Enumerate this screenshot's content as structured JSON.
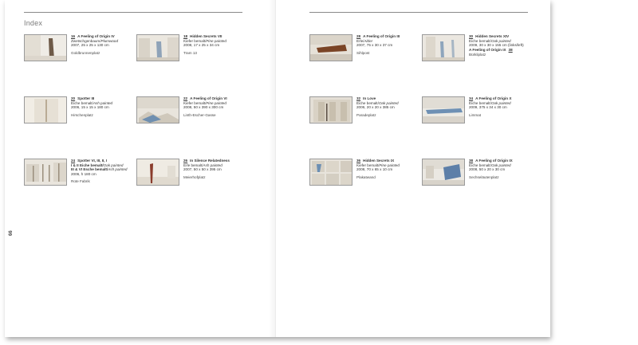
{
  "heading": "Index",
  "page_number": "66",
  "left_items": [
    {
      "num": "16",
      "title": "A Feeling of Origin IV",
      "material": "Zwetschgenbaum",
      "material_en": "Plumwood",
      "dims": "2007, 25 x 25 x 130 cm",
      "location": "Goldbrunnenplatz"
    },
    {
      "num": "18",
      "title": "Hidden Secrets VII",
      "material": "Kiefer bemalt",
      "material_en": "Pine painted",
      "dims": "2008, 17 x 25 x 34 cm",
      "location": "Tram 13"
    },
    {
      "num": "20",
      "title": "Spotter III",
      "material": "Eiche bemalt",
      "material_en": "Ash painted",
      "dims": "2006, 15 x 15 x 180 cm",
      "location": "Hirschenplatz"
    },
    {
      "num": "22",
      "title": "A Feeling of Origin VI",
      "material": "Kiefer bemalt",
      "material_en": "Pine painted",
      "dims": "2008, 50 x 390 x 300 cm",
      "location": "Linth-Escher-Gasse"
    },
    {
      "num": "24",
      "title": "Spotter VI, III, II, I",
      "material": "I & II Eiche bemalt",
      "material_en": "Oak painted",
      "material2": "III & VI Esche bemalt",
      "material2_en": "Ash painted",
      "dims": "2006, h 180 cm",
      "location": "Rote Fabrik"
    },
    {
      "num": "26",
      "title": "In Silence Relatedness",
      "material": "Erle bemalt",
      "material_en": "Ash painted",
      "dims": "2007, 50 x 50 x 395 cm",
      "location": "Meierhofplatz"
    }
  ],
  "right_items": [
    {
      "num": "28",
      "title": "A Feeling of Origin III",
      "material": "Erle",
      "material_en": "Alder",
      "dims": "2007, 75 x 30 x 37 cm",
      "location": "Sihlpost"
    },
    {
      "num": "30",
      "title": "Hidden Secrets XIV",
      "material": "Eiche bemalt",
      "material_en": "Oak painted",
      "dims": "2009, 30 x 30 x 155 cm (links/left)",
      "extra": "A Feeling of Origin IX",
      "extra_num": "38",
      "location": "Bürkliplatz"
    },
    {
      "num": "32",
      "title": "In Love",
      "material": "Eiche bemalt",
      "material_en": "Oak painted",
      "dims": "2006, 20 x 20 x 385 cm",
      "location": "Paradeplatz"
    },
    {
      "num": "34",
      "title": "A Feeling of Origin X",
      "material": "Eiche bemalt",
      "material_en": "Oak painted",
      "dims": "2009, 375 x 34 x 30 cm",
      "location": "Limmat"
    },
    {
      "num": "36",
      "title": "Hidden Secrets IX",
      "material": "Kiefer bemalt",
      "material_en": "Pine painted",
      "dims": "2008, 70 x 65 x 10 cm",
      "location": "Plakatwand"
    },
    {
      "num": "38",
      "title": "A Feeling of Origin IX",
      "material": "Eiche bemalt",
      "material_en": "Oak painted",
      "dims": "2008, 50 x 20 x 30 cm",
      "location": "Sechseläutenplatz"
    }
  ]
}
